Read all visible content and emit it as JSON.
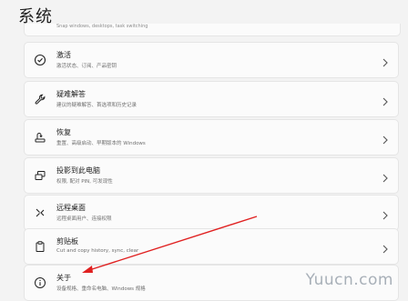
{
  "page": {
    "title": "系统",
    "top_card_desc": "Snap windows, desktops, task switching"
  },
  "items": [
    {
      "title": "激活",
      "desc": "激活状态、订阅、产品密钥",
      "icon": "check-circle-icon"
    },
    {
      "title": "疑难解答",
      "desc": "建议的疑难解答、首选项和历史记录",
      "icon": "wrench-icon"
    },
    {
      "title": "恢复",
      "desc": "重置、高级启动、早期版本的 Windows",
      "icon": "recovery-icon"
    },
    {
      "title": "投影到此电脑",
      "desc": "权限, 配对 PIN, 可发现性",
      "icon": "project-icon"
    },
    {
      "title": "远程桌面",
      "desc": "远程桌面用户、连接权限",
      "icon": "remote-desktop-icon"
    },
    {
      "title": "剪贴板",
      "desc": "Cut and copy history, sync, clear",
      "icon": "clipboard-icon"
    },
    {
      "title": "关于",
      "desc": "设备规格、重命名电脑、Windows 规格",
      "icon": "info-icon"
    }
  ],
  "watermark": "Yuucn.com",
  "colors": {
    "background": "#f3f3f3",
    "card": "#fbfbfb",
    "annotation_arrow": "#e02020"
  }
}
